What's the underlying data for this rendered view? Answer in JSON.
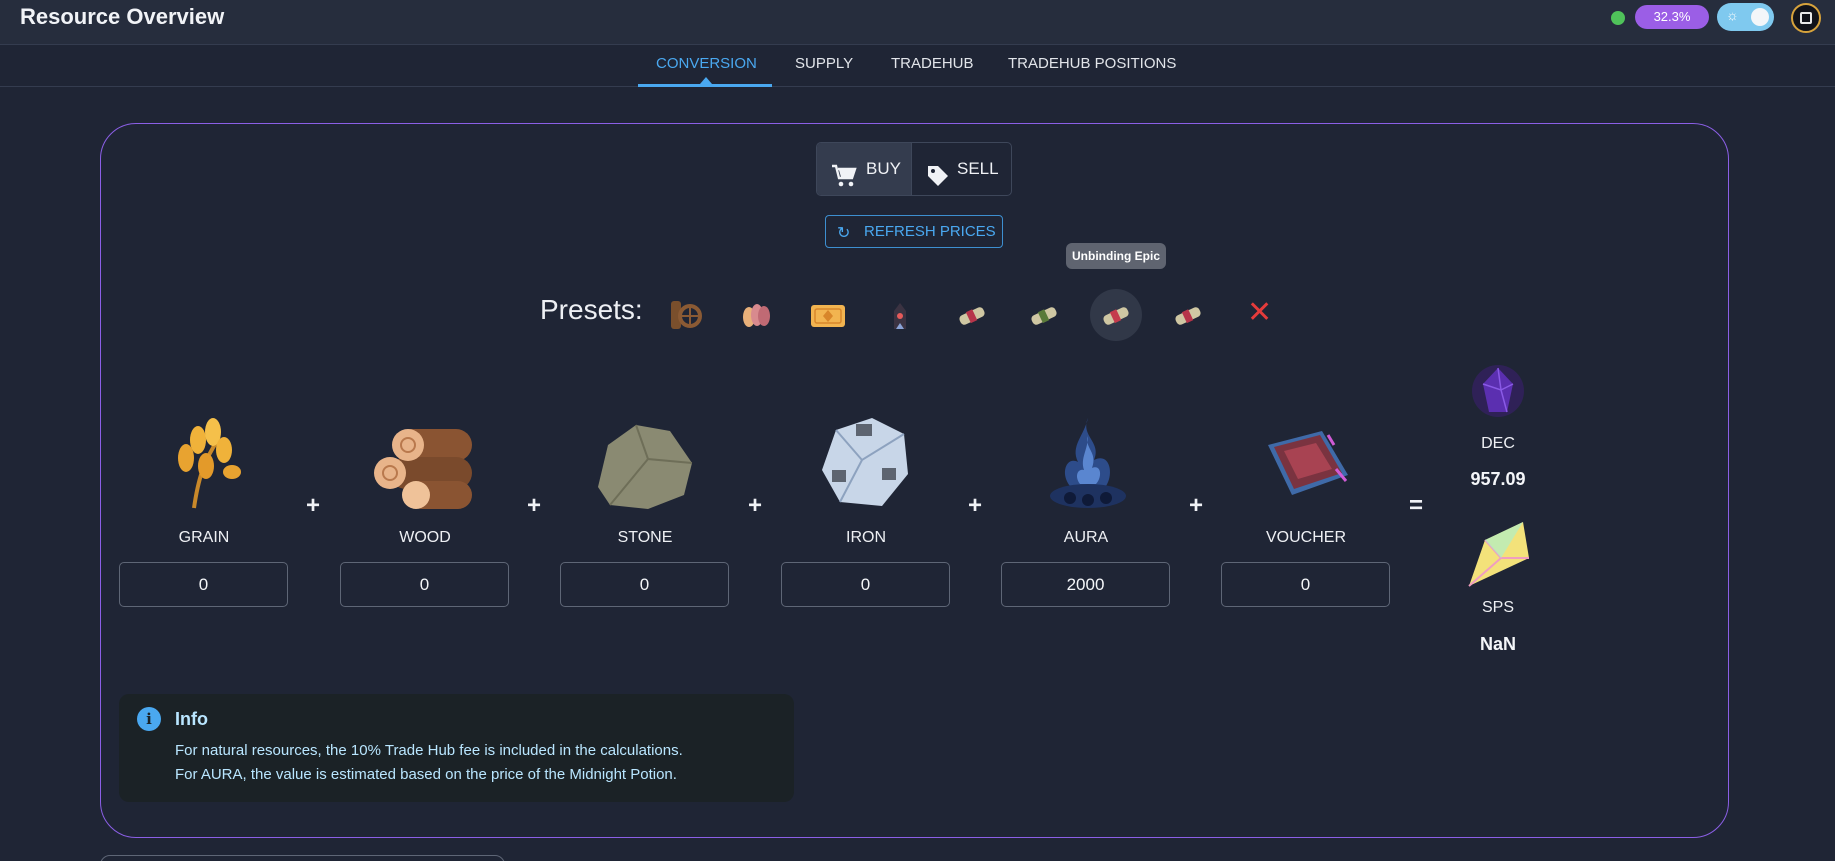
{
  "header": {
    "title": "Resource Overview",
    "percent": "32.3%",
    "status_color": "#4fc25a",
    "accent": "#9b5ee6"
  },
  "tabs": [
    {
      "label": "CONVERSION",
      "active": true
    },
    {
      "label": "SUPPLY",
      "active": false
    },
    {
      "label": "TRADEHUB",
      "active": false
    },
    {
      "label": "TRADEHUB POSITIONS",
      "active": false
    }
  ],
  "mode": {
    "buy_label": "BUY",
    "sell_label": "SELL",
    "selected": "BUY"
  },
  "refresh_label": "REFRESH PRICES",
  "tooltip": "Unbinding Epic",
  "presets": {
    "label": "Presets:",
    "items": [
      {
        "icon": "wood-and-wheel-icon"
      },
      {
        "icon": "seeds-icon"
      },
      {
        "icon": "ticket-icon"
      },
      {
        "icon": "totem-icon"
      },
      {
        "icon": "scroll-icon"
      },
      {
        "icon": "scroll-icon"
      },
      {
        "icon": "scroll-icon",
        "selected": true
      },
      {
        "icon": "scroll-icon"
      }
    ],
    "clear_icon": "close-icon"
  },
  "resources": [
    {
      "label": "GRAIN",
      "value": "0",
      "icon": "grain-icon"
    },
    {
      "label": "WOOD",
      "value": "0",
      "icon": "wood-icon"
    },
    {
      "label": "STONE",
      "value": "0",
      "icon": "stone-icon"
    },
    {
      "label": "IRON",
      "value": "0",
      "icon": "iron-icon"
    },
    {
      "label": "AURA",
      "value": "2000",
      "icon": "aura-icon"
    },
    {
      "label": "VOUCHER",
      "value": "0",
      "icon": "voucher-icon"
    }
  ],
  "operators": {
    "plus": "+",
    "equals": "="
  },
  "outputs": [
    {
      "label": "DEC",
      "value": "957.09",
      "icon": "dec-crystal-icon"
    },
    {
      "label": "SPS",
      "value": "NaN",
      "icon": "sps-shard-icon"
    }
  ],
  "info": {
    "title": "Info",
    "lines": [
      "For natural resources, the 10% Trade Hub fee is included in the calculations.",
      "For AURA, the value is estimated based on the price of the Midnight Potion."
    ]
  }
}
